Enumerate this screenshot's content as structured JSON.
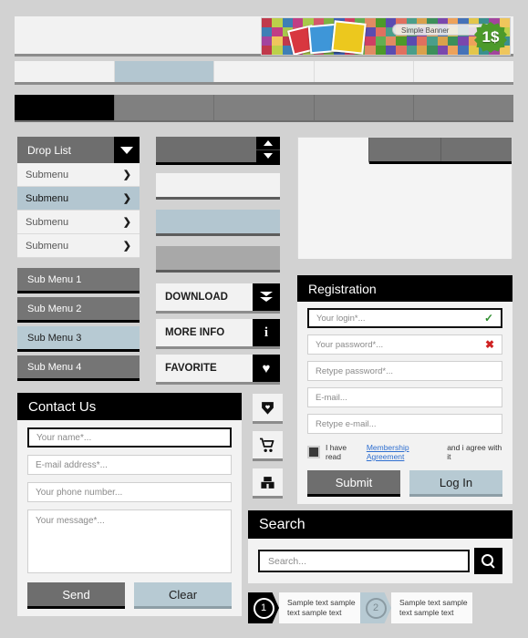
{
  "banner": {
    "label": "Simple Banner",
    "price": "1$",
    "mosaic_colors": [
      "#c0394b",
      "#d4586a",
      "#e08a63",
      "#d9a14c",
      "#e3c64a",
      "#bcd04a",
      "#7fb241",
      "#4c9a2a",
      "#3c8f5a",
      "#3b8f8f",
      "#3e7fb5",
      "#3e60b5",
      "#5a4cb0",
      "#7a47ad",
      "#a3449e",
      "#c03f85",
      "#cf3f63",
      "#e0705f",
      "#eda25a",
      "#efc65c",
      "#a8c94b",
      "#63ae52",
      "#4a9e8a",
      "#4472b8"
    ]
  },
  "nav": {
    "light_cells": 5,
    "light_active_index": 1,
    "dark_cells": 5,
    "dark_active_index": 0
  },
  "drop_list": {
    "title": "Drop List",
    "caret_icon": "chevron-down-icon",
    "items": [
      {
        "label": "Submenu",
        "arrow": "❯"
      },
      {
        "label": "Submenu",
        "arrow": "❯"
      },
      {
        "label": "Submenu",
        "arrow": "❯"
      },
      {
        "label": "Submenu",
        "arrow": "❯"
      }
    ],
    "active_index": 1
  },
  "sub_menus": {
    "items": [
      "Sub Menu 1",
      "Sub Menu 2",
      "Sub Menu 3",
      "Sub Menu 4"
    ],
    "active_index": 2
  },
  "contact": {
    "title": "Contact Us",
    "name_placeholder": "Your name*...",
    "email_placeholder": "E-mail address*...",
    "phone_placeholder": "Your phone number...",
    "message_placeholder": "Your message*...",
    "send_label": "Send",
    "clear_label": "Clear"
  },
  "actions": {
    "download_label": "DOWNLOAD",
    "download_icon": "double-chevron-down-icon",
    "more_info_label": "MORE INFO",
    "more_info_icon": "info-icon",
    "more_info_glyph": "i",
    "favorite_label": "FAVORITE",
    "favorite_icon": "heart-icon",
    "favorite_glyph": "♥"
  },
  "icon_column": {
    "shield_icon": "shield-heart-icon",
    "cart_icon": "shopping-cart-icon",
    "store_icon": "store-icon"
  },
  "stepper": {
    "up_icon": "caret-up-icon",
    "down_icon": "caret-down-icon"
  },
  "tab_panel": {
    "tabs": 3,
    "active_index": 0
  },
  "registration": {
    "title": "Registration",
    "fields": [
      {
        "placeholder": "Your login*...",
        "status": "✓",
        "status_type": "ok"
      },
      {
        "placeholder": "Your password*...",
        "status": "✖",
        "status_type": "bad"
      },
      {
        "placeholder": "Retype password*...",
        "status": "",
        "status_type": "none"
      },
      {
        "placeholder": "E-mail...",
        "status": "",
        "status_type": "none"
      },
      {
        "placeholder": "Retype e-mail...",
        "status": "",
        "status_type": "none"
      }
    ],
    "agree_prefix": "I have read",
    "agree_link": "Membership Agreement",
    "agree_suffix": "and i agree with it",
    "submit_label": "Submit",
    "login_label": "Log In"
  },
  "search": {
    "title": "Search",
    "placeholder": "Search...",
    "button_icon": "magnifier-icon"
  },
  "steps": [
    {
      "number": "1",
      "text": "Sample text sample text sample text"
    },
    {
      "number": "2",
      "text": "Sample text sample text sample text"
    }
  ],
  "colors": {
    "page_bg": "#d2d2d2",
    "panel_bg": "#f2f2f2",
    "dark": "#000000",
    "gray": "#6e6e6e",
    "accent_blue": "#b7cad3",
    "link": "#2f6fd0",
    "ok": "#2f8f2f",
    "error": "#cf2222"
  }
}
